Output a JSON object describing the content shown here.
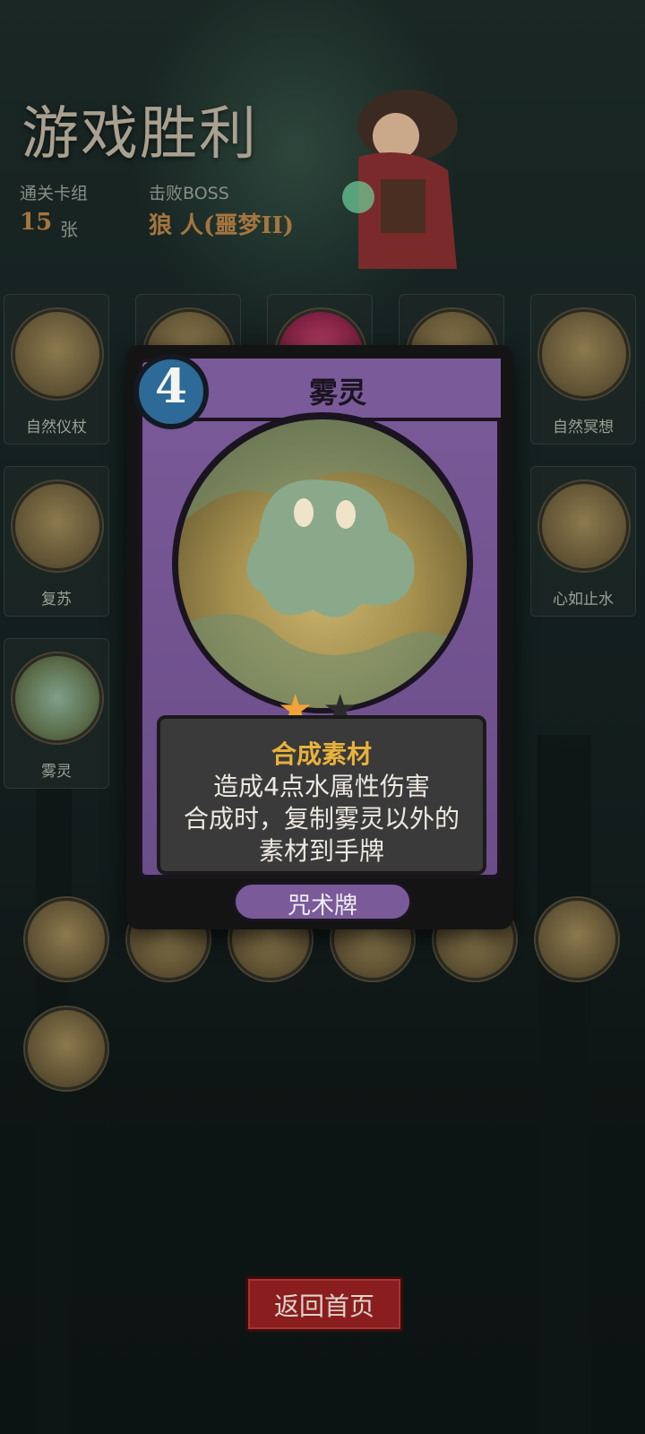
{
  "header": {
    "title": "游戏胜利",
    "deck_label": "通关卡组",
    "deck_count": "15",
    "deck_unit": "张",
    "boss_label": "击败BOSS",
    "boss_name": "狼 人(噩梦II)"
  },
  "deck_slots": [
    {
      "label": "自然仪杖",
      "icon": "staff-icon"
    },
    {
      "label": "",
      "icon": "arrow-icon"
    },
    {
      "label": "",
      "icon": "flower-icon"
    },
    {
      "label": "",
      "icon": "figure-icon"
    },
    {
      "label": "自然冥想",
      "icon": "meditation-icon"
    },
    {
      "label": "复苏",
      "icon": "sprout-icon"
    },
    {
      "label": "心如止水",
      "icon": "water-stone-icon"
    },
    {
      "label": "雾灵",
      "icon": "mist-spirit-icon"
    }
  ],
  "card": {
    "cost": "4",
    "name": "雾灵",
    "stars_filled": 1,
    "stars_total": 2,
    "subtitle": "合成素材",
    "desc_line1": "造成4点水属性伤害",
    "desc_line2": "合成时，复制雾灵以外的",
    "desc_line3": "素材到手牌",
    "type": "咒术牌",
    "colors": {
      "frame": "#6b4d8a",
      "cost": "#2d6a97",
      "subtitle": "#e8b23c",
      "star_on": "#f0a33a",
      "star_off": "#2b2b2b"
    }
  },
  "rewards": [
    "water-plant-icon",
    "creature-icon",
    "gold-icon",
    "cloak-icon",
    "hand-icon",
    "bubble-icon",
    "sword-icon"
  ],
  "footer": {
    "home_label": "返回首页",
    "button_color": "#8a1e1e"
  }
}
